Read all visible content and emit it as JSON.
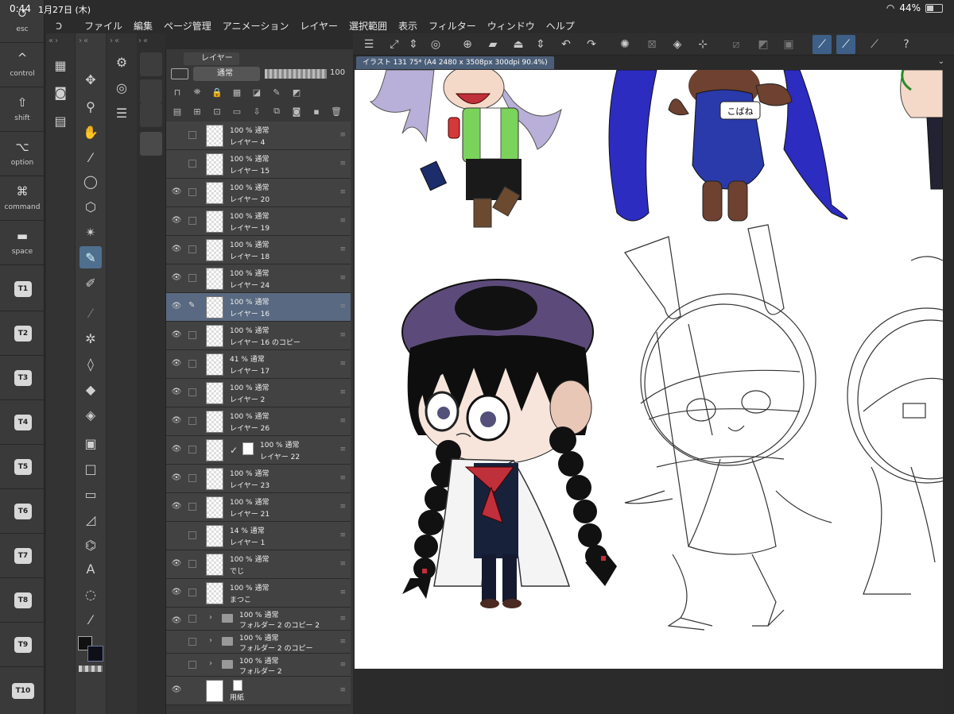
{
  "status_bar": {
    "time": "0:44",
    "date": "1月27日 (木)",
    "battery": "44%",
    "battery_level": 0.44
  },
  "menu": [
    "ファイル",
    "編集",
    "ページ管理",
    "アニメーション",
    "レイヤー",
    "選択範囲",
    "表示",
    "フィルター",
    "ウィンドウ",
    "ヘルプ"
  ],
  "modifiers": [
    {
      "symbol": "↺",
      "label": "esc"
    },
    {
      "symbol": "^",
      "label": "control"
    },
    {
      "symbol": "⇧",
      "label": "shift"
    },
    {
      "symbol": "⌥",
      "label": "option"
    },
    {
      "symbol": "⌘",
      "label": "command"
    },
    {
      "symbol": "▬",
      "label": "space"
    }
  ],
  "tbuttons": [
    "T1",
    "T2",
    "T3",
    "T4",
    "T5",
    "T6",
    "T7",
    "T8",
    "T9",
    "T10"
  ],
  "layer_panel": {
    "tab_label": "レイヤー",
    "blend_mode": "通常",
    "opacity_value": "100",
    "layers": [
      {
        "mode": "100 % 通常",
        "name": "レイヤー 4",
        "visible": false
      },
      {
        "mode": "100 % 通常",
        "name": "レイヤー 15",
        "visible": false
      },
      {
        "mode": "100 % 通常",
        "name": "レイヤー 20",
        "visible": true
      },
      {
        "mode": "100 % 通常",
        "name": "レイヤー 19",
        "visible": true
      },
      {
        "mode": "100 % 通常",
        "name": "レイヤー 18",
        "visible": true
      },
      {
        "mode": "100 % 通常",
        "name": "レイヤー 24",
        "visible": true
      },
      {
        "mode": "100 % 通常",
        "name": "レイヤー 16",
        "visible": true,
        "selected": true
      },
      {
        "mode": "100 % 通常",
        "name": "レイヤー 16 のコピー",
        "visible": true
      },
      {
        "mode": "41 % 通常",
        "name": "レイヤー 17",
        "visible": true
      },
      {
        "mode": "100 % 通常",
        "name": "レイヤー 2",
        "visible": true
      },
      {
        "mode": "100 % 通常",
        "name": "レイヤー 26",
        "visible": true
      },
      {
        "mode": "100 % 通常",
        "name": "レイヤー 22",
        "visible": true,
        "masked": true
      },
      {
        "mode": "100 % 通常",
        "name": "レイヤー 23",
        "visible": true
      },
      {
        "mode": "100 % 通常",
        "name": "レイヤー 21",
        "visible": true
      },
      {
        "mode": "14 % 通常",
        "name": "レイヤー 1",
        "visible": false
      },
      {
        "mode": "100 % 通常",
        "name": "でじ",
        "visible": true
      },
      {
        "mode": "100 % 通常",
        "name": "まつこ",
        "visible": true
      }
    ],
    "folders": [
      {
        "mode": "100 % 通常",
        "name": "フォルダー 2 のコピー 2",
        "visible": true
      },
      {
        "mode": "100 % 通常",
        "name": "フォルダー 2 のコピー",
        "visible": false
      },
      {
        "mode": "100 % 通常",
        "name": "フォルダー 2",
        "visible": false
      }
    ],
    "paper": {
      "name": "用紙",
      "visible": true
    }
  },
  "document": {
    "tab_title": "イラスト 131 75* (A4 2480 x 3508px 300dpi 90.4%)"
  },
  "canvas_label": "こばね"
}
